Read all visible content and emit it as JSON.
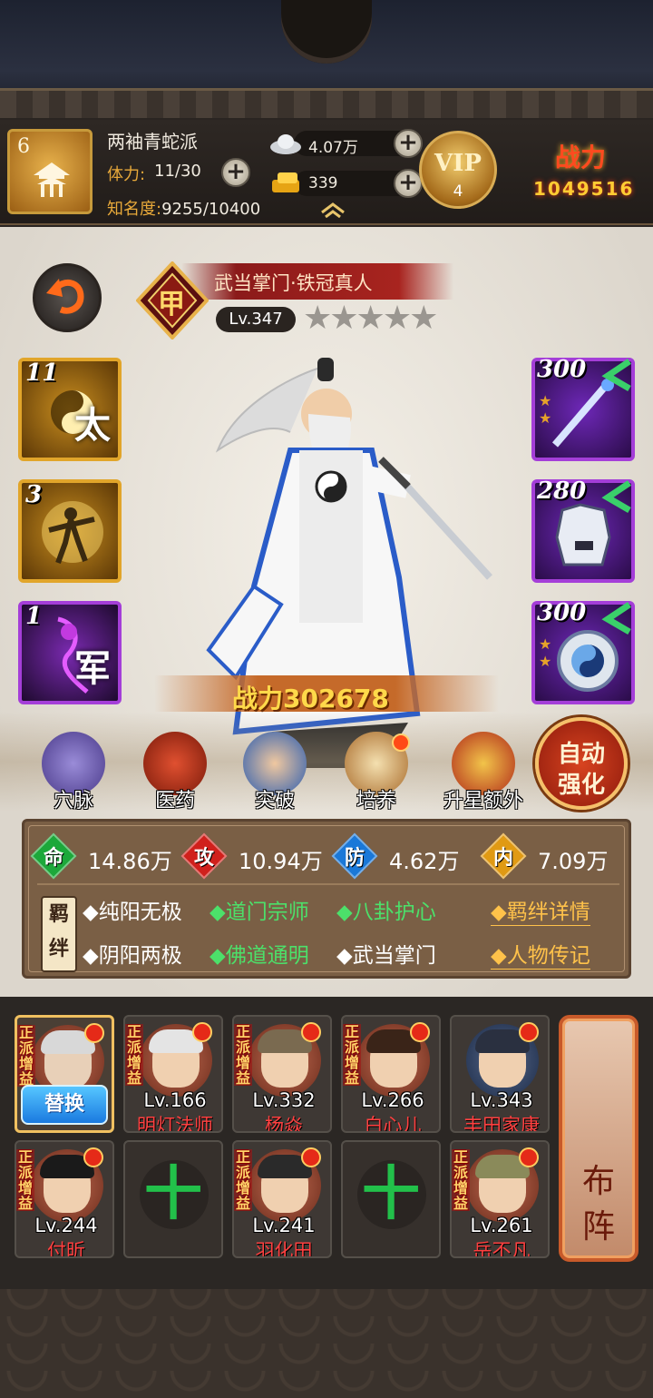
{
  "topbar": {
    "sect_level": "6",
    "sect_name": "两袖青蛇派",
    "stamina_label": "体力:",
    "stamina_value": "11/30",
    "fame_label": "知名度:",
    "fame_value": "9255/10400",
    "silver": "4.07万",
    "gold": "339",
    "vip_label": "VIP",
    "vip_level": "4",
    "power_label": "战力",
    "power_value": "1049516"
  },
  "hero": {
    "title": "武当掌门·铁冠真人",
    "rank_badge": "甲",
    "level": "Lv.347",
    "stars": "★★★★★",
    "star_count": 5,
    "power_text": "战力302678"
  },
  "skills": [
    {
      "num": "11",
      "glyph": "太"
    },
    {
      "num": "3",
      "glyph": ""
    },
    {
      "num": "1",
      "glyph": "军"
    }
  ],
  "equipment": [
    {
      "num": "300",
      "icon": "sword-icon"
    },
    {
      "num": "280",
      "icon": "armor-icon"
    },
    {
      "num": "300",
      "icon": "bagua-mirror-icon"
    }
  ],
  "functions": [
    {
      "label": "穴脉"
    },
    {
      "label": "医药"
    },
    {
      "label": "突破"
    },
    {
      "label": "培养"
    },
    {
      "label": "升星额外"
    }
  ],
  "auto_button": {
    "line1": "自动",
    "line2": "强化"
  },
  "stats": [
    {
      "char": "命",
      "value": "14.86万",
      "color": "#1ca83a"
    },
    {
      "char": "攻",
      "value": "10.94万",
      "color": "#d0201c"
    },
    {
      "char": "防",
      "value": "4.62万",
      "color": "#1a78d8"
    },
    {
      "char": "内",
      "value": "7.09万",
      "color": "#e09a14"
    }
  ],
  "fetters": {
    "badge": "羁绊",
    "row1": [
      "◆纯阳无极",
      "◆道门宗师",
      "◆八卦护心"
    ],
    "row2": [
      "◆阴阳两极",
      "◆佛道通明",
      "◆武当掌门"
    ],
    "link1": "◆羁绊详情",
    "link2": "◆人物传记"
  },
  "lineup": {
    "tag": "正派增益",
    "swap_label": "替换",
    "formation_line1": "布",
    "formation_line2": "阵",
    "heroes": [
      {
        "level": "Lv.166",
        "name": "明灯法师"
      },
      {
        "level": "Lv.332",
        "name": "杨焱"
      },
      {
        "level": "Lv.266",
        "name": "白心儿"
      },
      {
        "level": "Lv.343",
        "name": "丰田家康"
      },
      {
        "level": "Lv.244",
        "name": "付昕"
      },
      {
        "level": "Lv.241",
        "name": "羽化田"
      },
      {
        "level": "Lv.261",
        "name": "岳不凡"
      }
    ],
    "empty_symbol": "十"
  }
}
